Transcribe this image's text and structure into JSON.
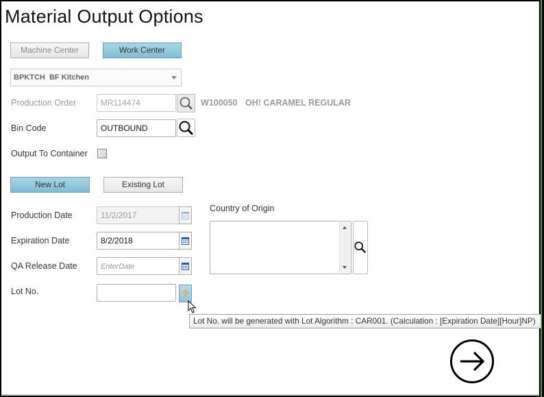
{
  "title": "Material Output Options",
  "center_toggle": {
    "machine_center_label": "Machine Center",
    "work_center_label": "Work Center",
    "selected": "Work Center"
  },
  "work_center_select": {
    "value": "BPKTCH  BF Kitchen"
  },
  "production_order": {
    "label": "Production Order",
    "value": "MR114474",
    "item_no": "W100050",
    "item_description": "OH! CARAMEL REGULAR",
    "search_icon": "search-icon"
  },
  "bin_code": {
    "label": "Bin Code",
    "value": "OUTBOUND",
    "search_icon": "search-icon"
  },
  "output_to_container": {
    "label": "Output To Container",
    "checked": false
  },
  "lot_toggle": {
    "new_lot_label": "New Lot",
    "existing_lot_label": "Existing Lot",
    "selected": "New Lot"
  },
  "production_date": {
    "label": "Production Date",
    "value": "11/2/2017",
    "icon": "calendar-icon"
  },
  "expiration_date": {
    "label": "Expiration Date",
    "value": "8/2/2018",
    "icon": "calendar-icon"
  },
  "qa_release_date": {
    "label": "QA Release Date",
    "value": "",
    "placeholder": "EnterDate",
    "icon": "calendar-icon"
  },
  "country_of_origin": {
    "label": "Country of Origin",
    "value": "",
    "search_icon": "search-icon"
  },
  "lot_no": {
    "label": "Lot No.",
    "value": "",
    "help_glyph": "?",
    "tooltip": "Lot No. will be generated with Lot Algorithm : CAR001. (Calculation : [Expiration Date][Hour]NP)"
  },
  "next_button": {
    "icon": "arrow-right-circle-icon"
  },
  "colors": {
    "active_button": "#7ebdd6",
    "accent_edge": "#6f9a3a"
  }
}
